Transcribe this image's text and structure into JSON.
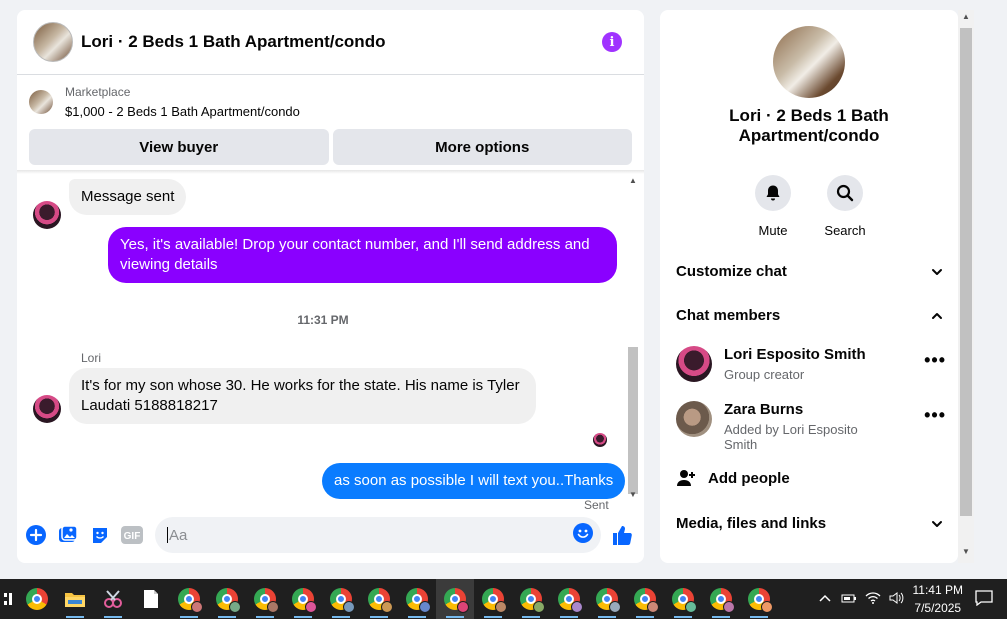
{
  "chat": {
    "title": "Lori · 2 Beds 1 Bath Apartment/condo",
    "marketplace_label": "Marketplace",
    "marketplace_item": "$1,000 - 2 Beds 1 Bath Apartment/condo",
    "view_buyer": "View buyer",
    "more_options": "More options",
    "messages": [
      {
        "text": "Message sent"
      },
      {
        "text": "Yes, it's available! Drop your contact number, and I'll send address and viewing details"
      },
      {
        "text": "It's for my son whose 30. He works for the state.  His name is Tyler Laudati 5188818217"
      },
      {
        "text": "as soon as possible I will text you..Thanks"
      }
    ],
    "timestamp": "11:31 PM",
    "sender_name": "Lori",
    "sent_status": "Sent",
    "input_placeholder": "Aa"
  },
  "side": {
    "title": "Lori · 2 Beds 1 Bath Apartment/condo",
    "mute_label": "Mute",
    "search_label": "Search",
    "customize_chat": "Customize chat",
    "chat_members": "Chat members",
    "members": [
      {
        "name": "Lori Esposito Smith",
        "sub": "Group creator"
      },
      {
        "name": "Zara Burns",
        "sub": "Added by Lori Esposito Smith"
      }
    ],
    "add_people": "Add people",
    "media_files_links": "Media, files and links"
  },
  "taskbar": {
    "time": "11:41 PM",
    "date": "7/5/2025"
  },
  "colors": {
    "accent_purple": "#a033ff",
    "bubble_purple": "#8a00ff",
    "bubble_blue": "#0a7cff"
  }
}
